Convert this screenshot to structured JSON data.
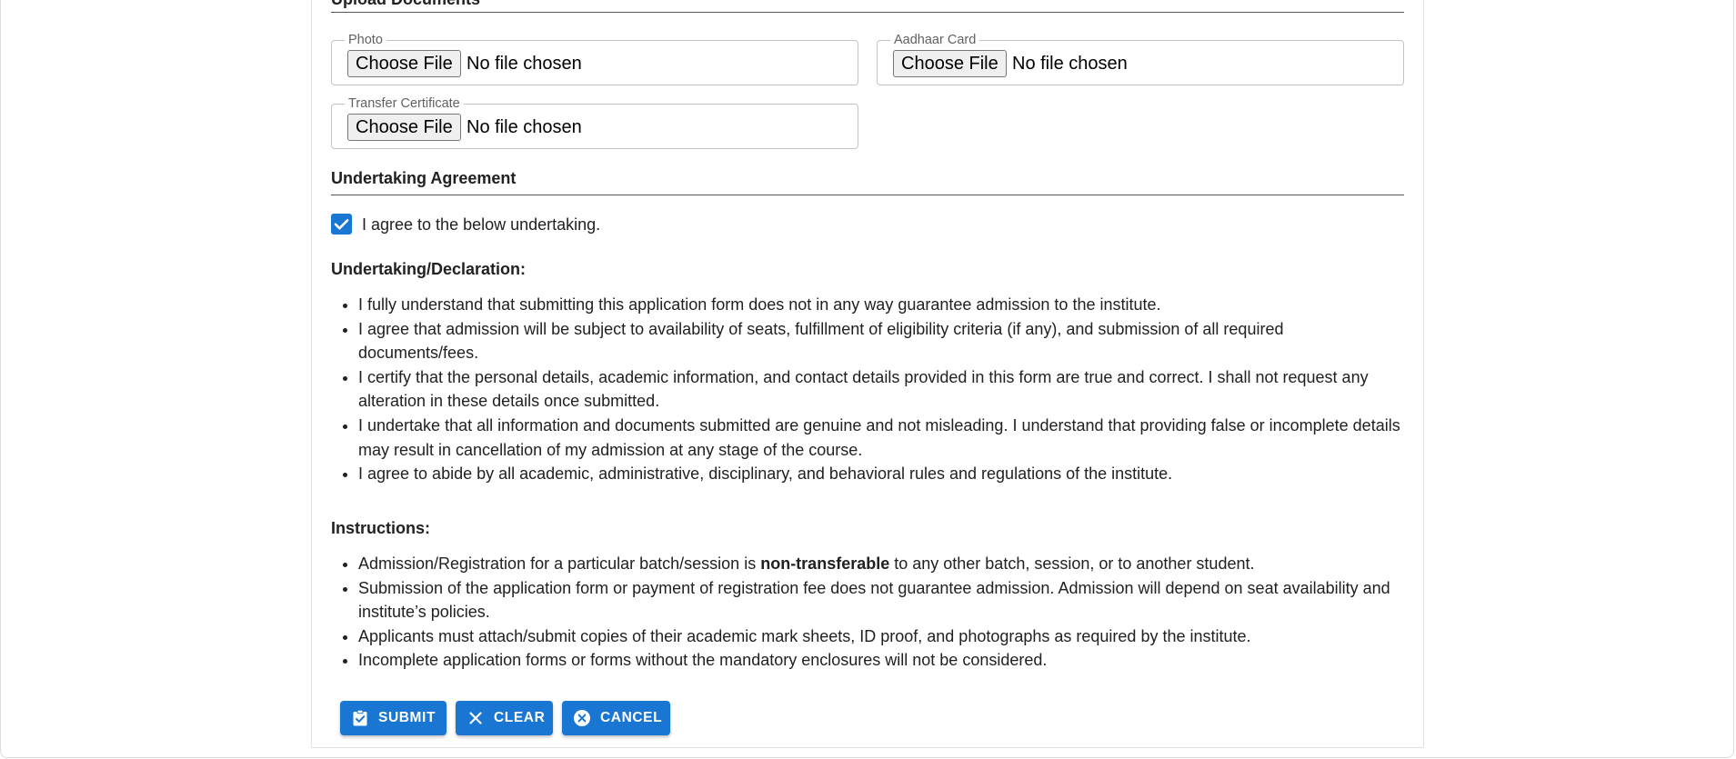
{
  "sections": {
    "upload_title": "Upload Documents",
    "undertaking_title": "Undertaking Agreement"
  },
  "files": {
    "photo": {
      "label": "Photo",
      "button": "Choose File",
      "status": "No file chosen"
    },
    "aadhaar": {
      "label": "Aadhaar Card",
      "button": "Choose File",
      "status": "No file chosen"
    },
    "transfer": {
      "label": "Transfer Certificate",
      "button": "Choose File",
      "status": "No file chosen"
    }
  },
  "agreement": {
    "checked": true,
    "label": "I agree to the below undertaking."
  },
  "declaration": {
    "title": "Undertaking/Declaration:",
    "items": [
      "I fully understand that submitting this application form does not in any way guarantee admission to the institute.",
      "I agree that admission will be subject to availability of seats, fulfillment of eligibility criteria (if any), and submission of all required documents/fees.",
      "I certify that the personal details, academic information, and contact details provided in this form are true and correct. I shall not request any alteration in these details once submitted.",
      "I undertake that all information and documents submitted are genuine and not misleading. I understand that providing false or incomplete details may result in cancellation of my admission at any stage of the course.",
      "I agree to abide by all academic, administrative, disciplinary, and behavioral rules and regulations of the institute."
    ]
  },
  "instructions": {
    "title": "Instructions:",
    "item1": {
      "before": "Admission/Registration for a particular batch/session is ",
      "bold": "non-transferable",
      "after": " to any other batch, session, or to another student."
    },
    "items": [
      "Submission of the application form or payment of registration fee does not guarantee admission. Admission will depend on seat availability and institute’s policies.",
      "Applicants must attach/submit copies of their academic mark sheets, ID proof, and photographs as required by the institute.",
      "Incomplete application forms or forms without the mandatory enclosures will not be considered."
    ]
  },
  "actions": {
    "submit": "SUBMIT",
    "clear": "CLEAR",
    "cancel": "CANCEL"
  },
  "colors": {
    "primary": "#1976d2",
    "text": "#212121",
    "muted": "#616161",
    "border": "#c4c4c4"
  }
}
